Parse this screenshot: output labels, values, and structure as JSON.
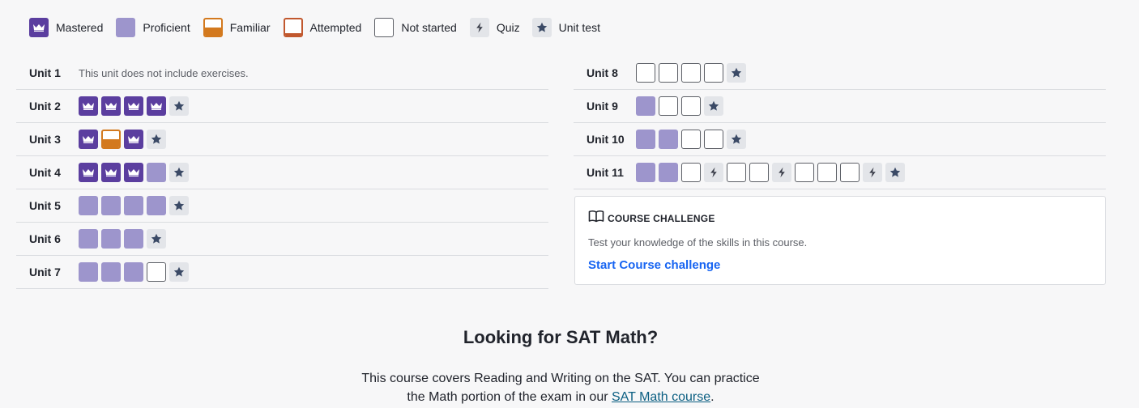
{
  "legend": [
    {
      "type": "mastered",
      "label": "Mastered"
    },
    {
      "type": "proficient",
      "label": "Proficient"
    },
    {
      "type": "familiar",
      "label": "Familiar"
    },
    {
      "type": "attempted",
      "label": "Attempted"
    },
    {
      "type": "notstarted",
      "label": "Not started"
    },
    {
      "type": "quiz",
      "label": "Quiz"
    },
    {
      "type": "unittest",
      "label": "Unit test"
    }
  ],
  "units_left": [
    {
      "name": "Unit 1",
      "note": "This unit does not include exercises.",
      "skills": []
    },
    {
      "name": "Unit 2",
      "note": "",
      "skills": [
        "mastered",
        "mastered",
        "mastered",
        "mastered",
        "unittest"
      ]
    },
    {
      "name": "Unit 3",
      "note": "",
      "skills": [
        "mastered",
        "familiar",
        "mastered",
        "unittest"
      ]
    },
    {
      "name": "Unit 4",
      "note": "",
      "skills": [
        "mastered",
        "mastered",
        "mastered",
        "proficient",
        "unittest"
      ]
    },
    {
      "name": "Unit 5",
      "note": "",
      "skills": [
        "proficient",
        "proficient",
        "proficient",
        "proficient",
        "unittest"
      ]
    },
    {
      "name": "Unit 6",
      "note": "",
      "skills": [
        "proficient",
        "proficient",
        "proficient",
        "unittest"
      ]
    },
    {
      "name": "Unit 7",
      "note": "",
      "skills": [
        "proficient",
        "proficient",
        "proficient",
        "notstarted",
        "unittest"
      ]
    }
  ],
  "units_right": [
    {
      "name": "Unit 8",
      "note": "",
      "skills": [
        "notstarted",
        "notstarted",
        "notstarted",
        "notstarted",
        "unittest"
      ]
    },
    {
      "name": "Unit 9",
      "note": "",
      "skills": [
        "proficient",
        "notstarted",
        "notstarted",
        "unittest"
      ]
    },
    {
      "name": "Unit 10",
      "note": "",
      "skills": [
        "proficient",
        "proficient",
        "notstarted",
        "notstarted",
        "unittest"
      ]
    },
    {
      "name": "Unit 11",
      "note": "",
      "skills": [
        "proficient",
        "proficient",
        "notstarted",
        "quiz",
        "notstarted",
        "notstarted",
        "quiz",
        "notstarted",
        "notstarted",
        "notstarted",
        "quiz",
        "unittest"
      ]
    }
  ],
  "challenge": {
    "icon": "book-icon",
    "title": "COURSE CHALLENGE",
    "description": "Test your knowledge of the skills in this course.",
    "link_label": "Start Course challenge"
  },
  "sat": {
    "heading": "Looking for SAT Math?",
    "line1": "This course covers Reading and Writing on the SAT. You can practice",
    "line2_prefix": "the Math portion of the exam in our ",
    "link_label": "SAT Math course",
    "line2_suffix": "."
  },
  "colors": {
    "mastered": "#5b3e9f",
    "proficient": "#9d95cc",
    "familiar": "#d3791e",
    "attempted": "#c1582e",
    "link": "#1865f2"
  }
}
